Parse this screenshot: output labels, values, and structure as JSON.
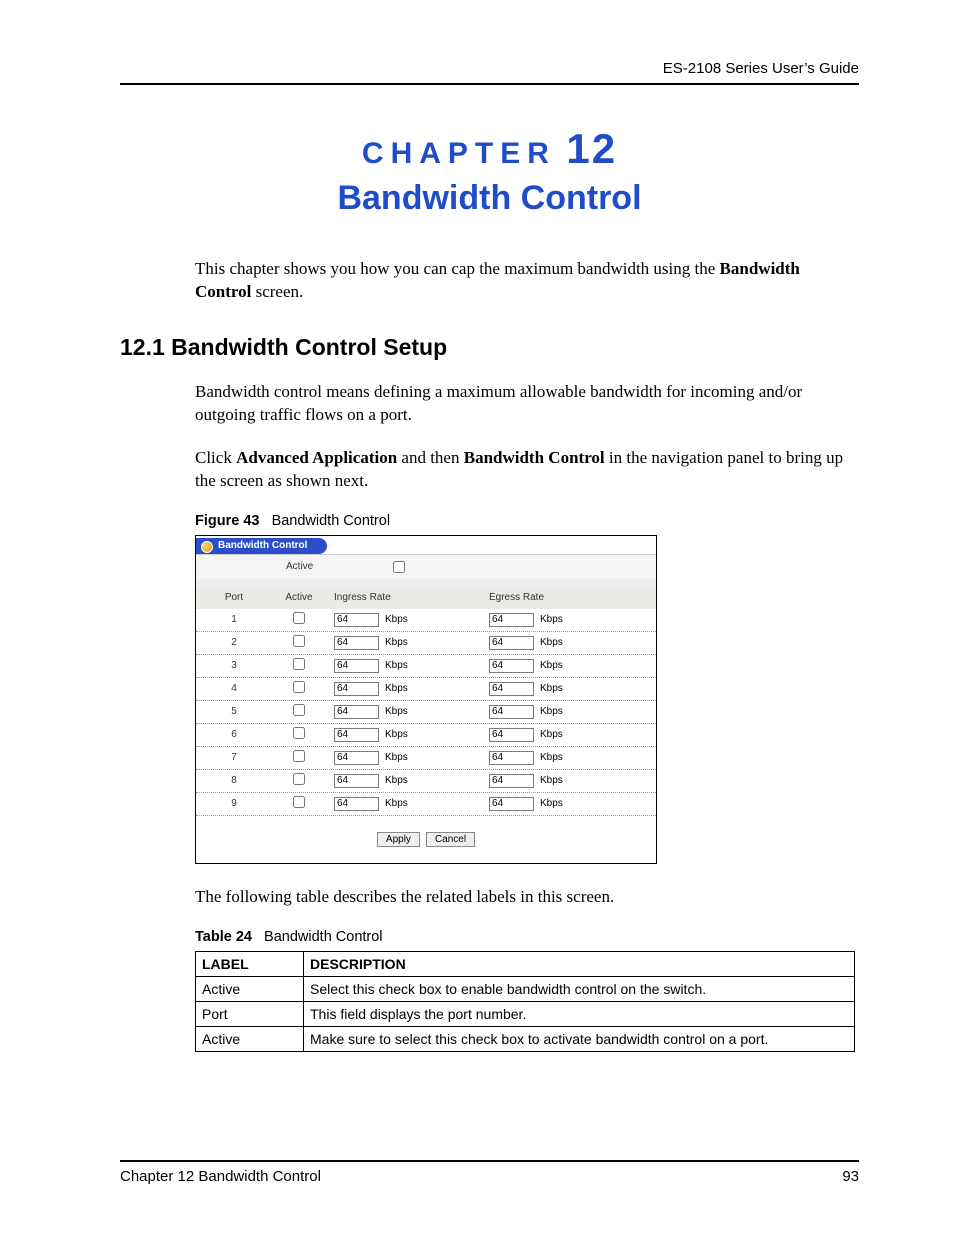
{
  "header": {
    "guide": "ES-2108 Series User’s Guide"
  },
  "chapter": {
    "eyebrow": "CHAPTER",
    "number": "12",
    "name": "Bandwidth Control"
  },
  "intro": {
    "p1a": "This chapter shows you how you can cap the maximum bandwidth using the ",
    "p1b": "Bandwidth Control",
    "p1c": " screen."
  },
  "section": {
    "heading": "12.1  Bandwidth Control Setup"
  },
  "body": {
    "p2": "Bandwidth control means defining a maximum allowable bandwidth for incoming and/or outgoing traffic flows on a port.",
    "p3a": "Click ",
    "p3b": "Advanced Application",
    "p3c": " and then ",
    "p3d": "Bandwidth Control",
    "p3e": " in the navigation panel to bring up the screen as shown next.",
    "p4": "The following table describes the related labels in this screen."
  },
  "figure": {
    "label": "Figure 43",
    "title": "Bandwidth Control"
  },
  "screenshot": {
    "tab": "Bandwidth Control",
    "global_active_label": "Active",
    "headers": {
      "port": "Port",
      "active": "Active",
      "ingress": "Ingress Rate",
      "egress": "Egress Rate"
    },
    "unit": "Kbps",
    "rows": [
      {
        "port": "1",
        "ingress": "64",
        "egress": "64"
      },
      {
        "port": "2",
        "ingress": "64",
        "egress": "64"
      },
      {
        "port": "3",
        "ingress": "64",
        "egress": "64"
      },
      {
        "port": "4",
        "ingress": "64",
        "egress": "64"
      },
      {
        "port": "5",
        "ingress": "64",
        "egress": "64"
      },
      {
        "port": "6",
        "ingress": "64",
        "egress": "64"
      },
      {
        "port": "7",
        "ingress": "64",
        "egress": "64"
      },
      {
        "port": "8",
        "ingress": "64",
        "egress": "64"
      },
      {
        "port": "9",
        "ingress": "64",
        "egress": "64"
      }
    ],
    "buttons": {
      "apply": "Apply",
      "cancel": "Cancel"
    }
  },
  "table": {
    "label": "Table 24",
    "title": "Bandwidth Control",
    "headers": {
      "label": "LABEL",
      "description": "DESCRIPTION"
    },
    "rows": [
      {
        "label": "Active",
        "description": "Select this check box to enable bandwidth control on the switch."
      },
      {
        "label": "Port",
        "description": "This field displays the port number."
      },
      {
        "label": "Active",
        "description": "Make sure to select this check box to activate bandwidth control on a port."
      }
    ]
  },
  "footer": {
    "left": "Chapter 12 Bandwidth Control",
    "right": "93"
  }
}
